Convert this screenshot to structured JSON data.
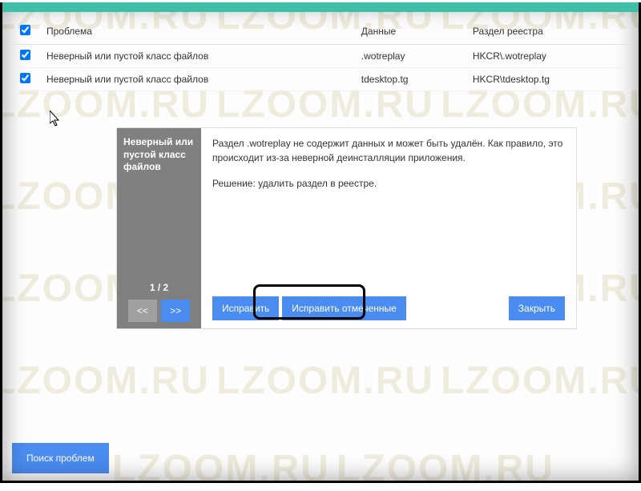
{
  "watermark_text": "LZOOM.RU",
  "table": {
    "headers": {
      "problem": "Проблема",
      "data": "Данные",
      "registry": "Раздел реестра"
    },
    "rows": [
      {
        "problem": "Неверный или пустой класс файлов",
        "data": ".wotreplay",
        "registry": "HKCR\\.wotreplay"
      },
      {
        "problem": "Неверный или пустой класс файлов",
        "data": "tdesktop.tg",
        "registry": "HKCR\\tdesktop.tg"
      }
    ]
  },
  "details": {
    "title": "Неверный или пустой класс файлов",
    "description": "Раздел .wotreplay не содержит данных и может быть удалён. Как правило, это происходит из-за неверной деинсталляции приложения.",
    "solution": "Решение: удалить раздел в реестре.",
    "pager_label": "1 / 2",
    "prev": "<<",
    "next": ">>",
    "fix": "Исправить",
    "fix_marked": "Исправить отмеченные",
    "close": "Закрыть"
  },
  "search_button": "Поиск проблем"
}
